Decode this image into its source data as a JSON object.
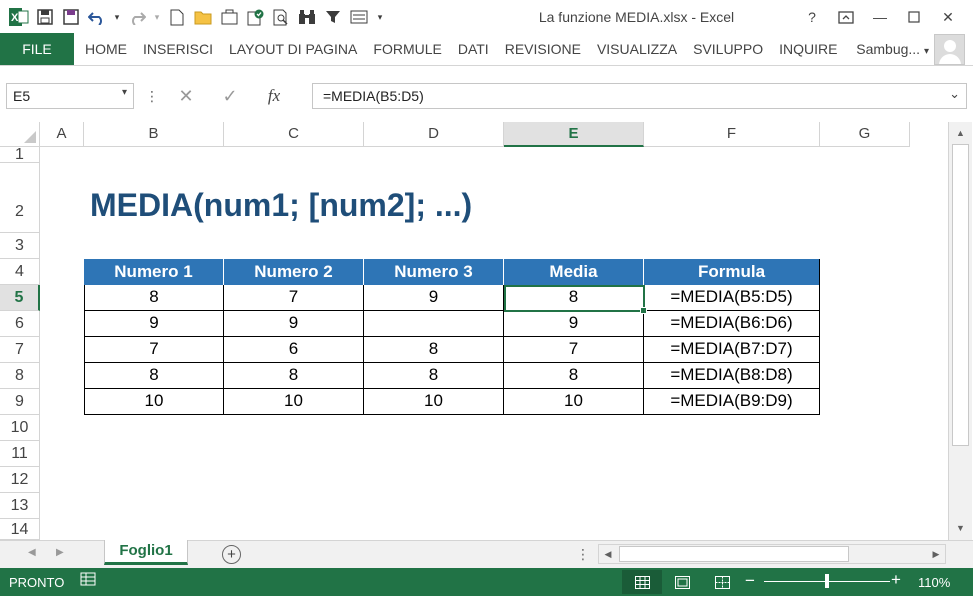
{
  "window": {
    "title": "La funzione MEDIA.xlsx - Excel",
    "help": "?",
    "restore_ribbon": "⧉",
    "minimize": "—",
    "maximize": "☐",
    "close": "✕"
  },
  "quick_access": {
    "app_icon": "X",
    "save": "💾",
    "undo": "↶",
    "redo": "↷",
    "customize": "▾"
  },
  "ribbon": {
    "file_tab": "FILE",
    "tabs": [
      "HOME",
      "INSERISCI",
      "LAYOUT DI PAGINA",
      "FORMULE",
      "DATI",
      "REVISIONE",
      "VISUALIZZA",
      "SVILUPPO",
      "INQUIRE"
    ],
    "user": "Sambug...",
    "user_dropdown": "▾"
  },
  "formula_bar": {
    "name_box": "E5",
    "formula": "=MEDIA(B5:D5)",
    "cancel": "✕",
    "enter": "✓",
    "fx": "fx",
    "dots": "⋮",
    "dd": "▾",
    "expand": "⌄"
  },
  "grid": {
    "columns": [
      "A",
      "B",
      "C",
      "D",
      "E",
      "F",
      "G"
    ],
    "rows": [
      "1",
      "2",
      "3",
      "4",
      "5",
      "6",
      "7",
      "8",
      "9",
      "10",
      "11",
      "12",
      "13",
      "14"
    ],
    "selected_column": "E",
    "selected_row": "5",
    "title": "MEDIA(num1; [num2]; ...)",
    "table": {
      "headers": [
        "Numero 1",
        "Numero 2",
        "Numero 3",
        "Media",
        "Formula"
      ],
      "rows": [
        [
          "8",
          "7",
          "9",
          "8",
          "=MEDIA(B5:D5)"
        ],
        [
          "9",
          "9",
          "",
          "9",
          "=MEDIA(B6:D6)"
        ],
        [
          "7",
          "6",
          "8",
          "7",
          "=MEDIA(B7:D7)"
        ],
        [
          "8",
          "8",
          "8",
          "8",
          "=MEDIA(B8:D8)"
        ],
        [
          "10",
          "10",
          "10",
          "10",
          "=MEDIA(B9:D9)"
        ]
      ]
    }
  },
  "sheets": {
    "active": "Foglio1",
    "add": "+",
    "prev": "◀",
    "next": "▶",
    "dots": "⋮"
  },
  "status": {
    "ready": "PRONTO",
    "zoom": "110%",
    "zoom_fraction": 0.5,
    "minus": "−",
    "plus": "+"
  },
  "colors": {
    "excel_green": "#217346",
    "header_blue": "#2e75b6",
    "title_blue": "#1f4e79"
  }
}
